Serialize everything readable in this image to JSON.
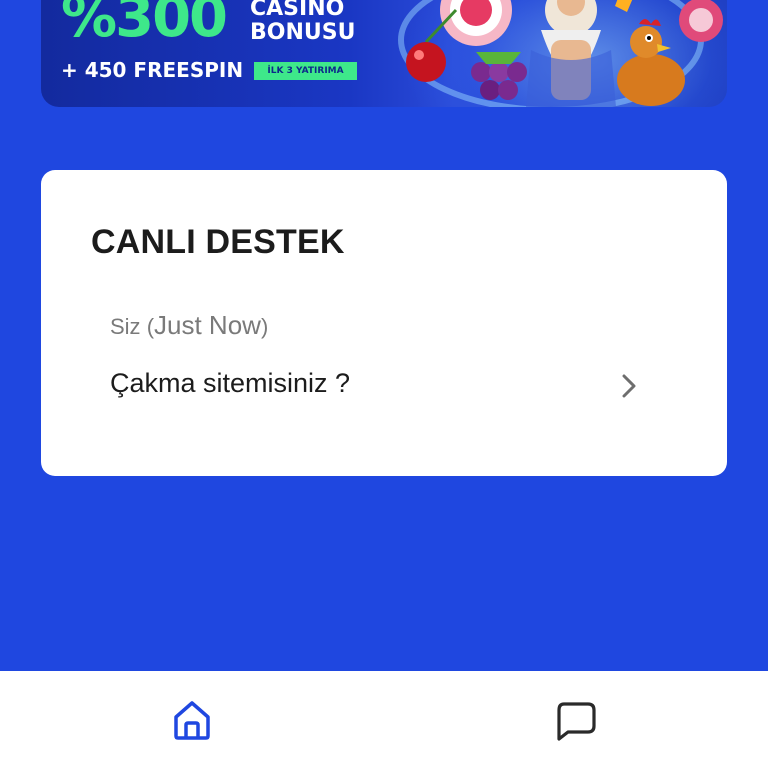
{
  "banner": {
    "percent": "%300",
    "casino_bonus": "CASINO\nBONUSU",
    "freespin": "+ 450 FREESPIN",
    "tag": "İLK 3 YATIRIMA"
  },
  "support": {
    "title": "CANLI DESTEK",
    "sender": "Siz",
    "time": "Just Now",
    "message": "Çakma sitemisiniz ?"
  },
  "bottom_nav": {
    "items": [
      {
        "icon": "home-icon",
        "active": true
      },
      {
        "icon": "chat-icon",
        "active": false
      }
    ]
  },
  "colors": {
    "background": "#1f47e0",
    "accent": "#1f47e0",
    "banner_green": "#3ee88a",
    "card": "#ffffff"
  }
}
